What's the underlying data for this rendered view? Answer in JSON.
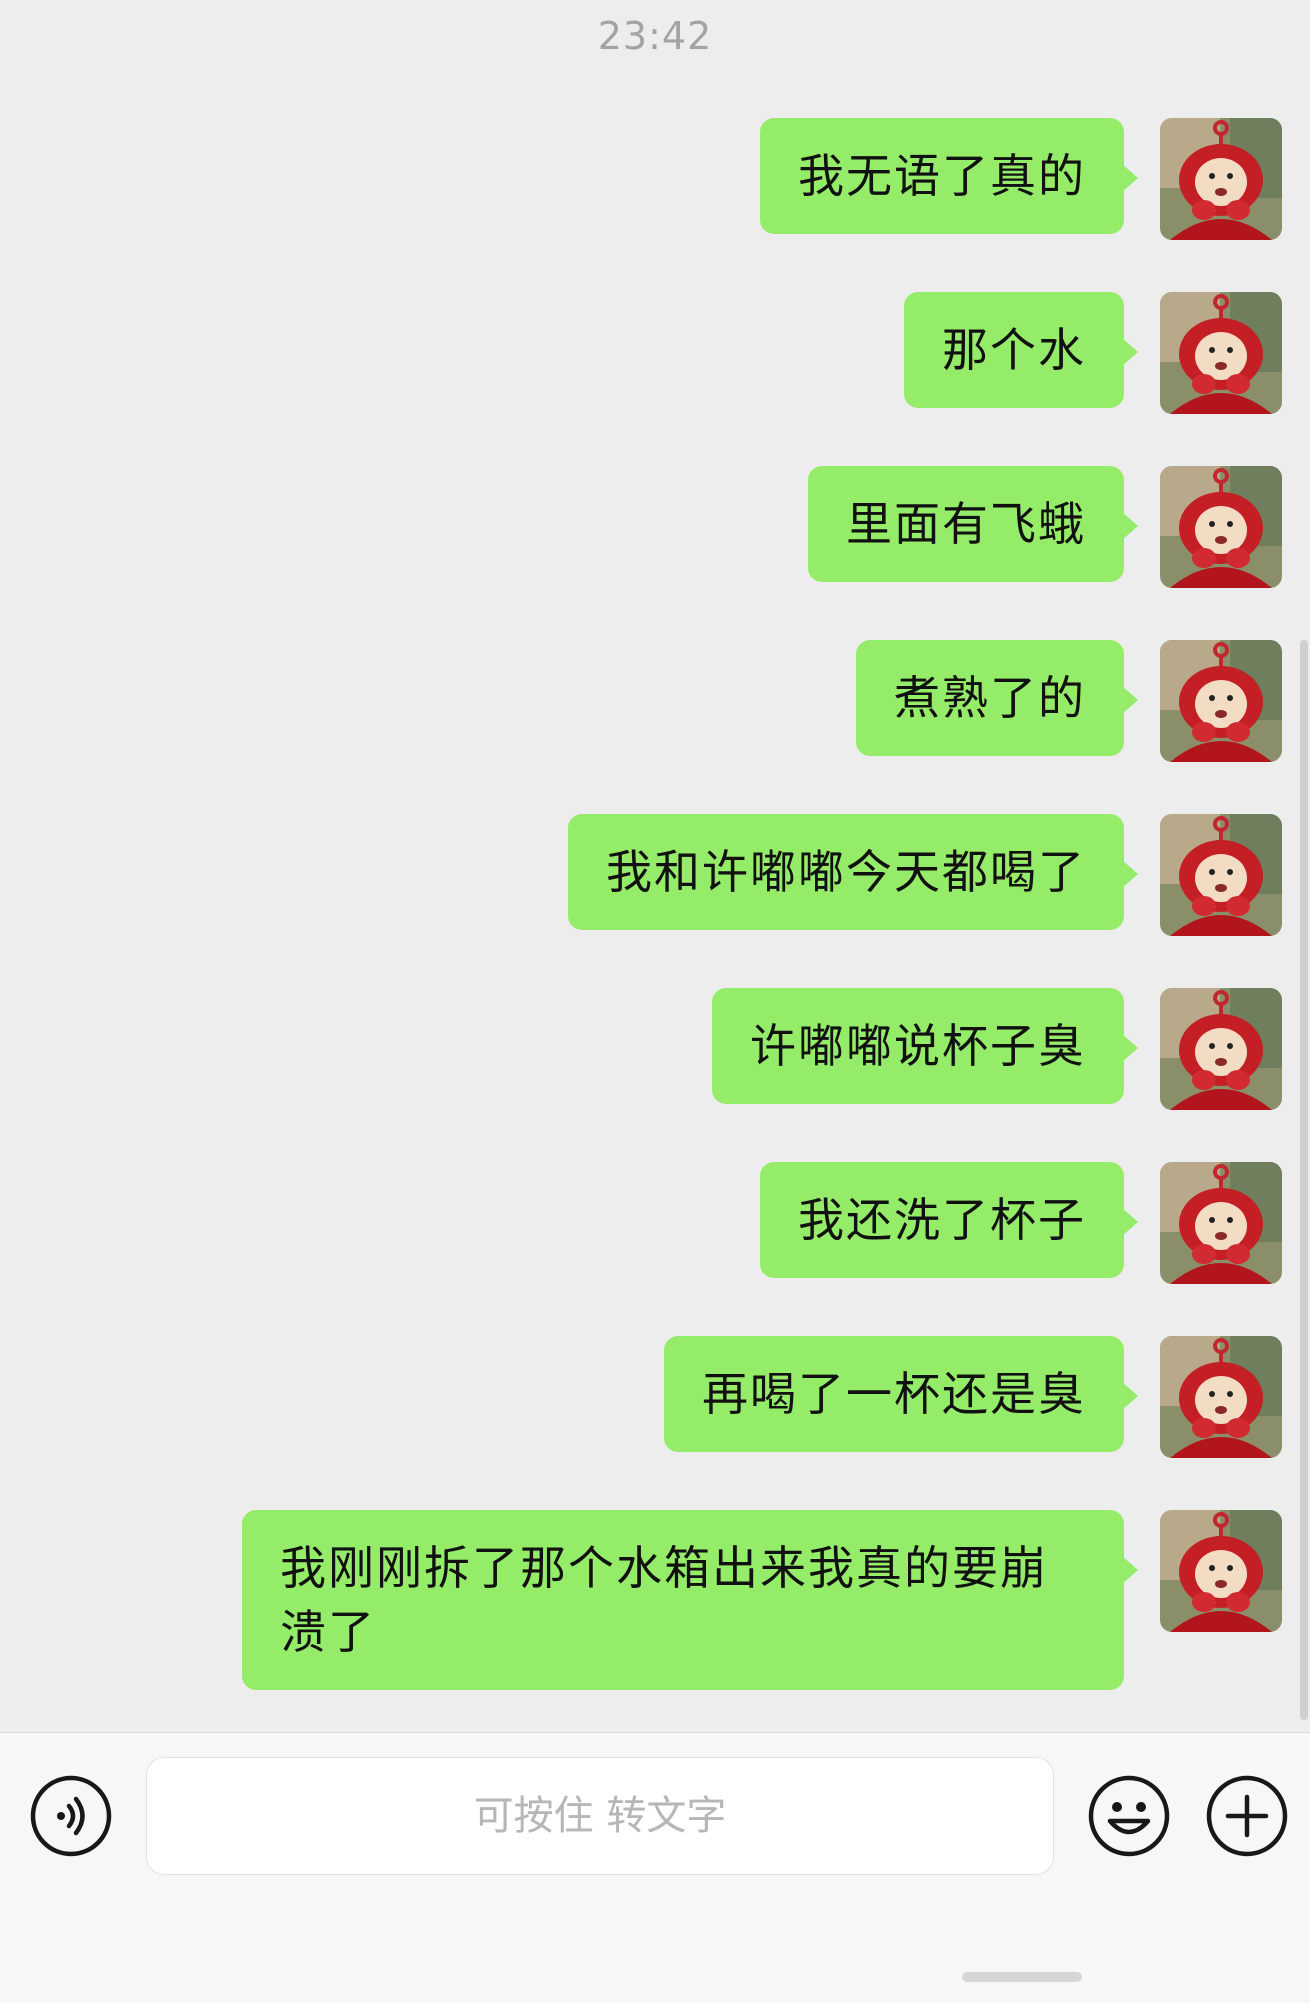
{
  "time_label": "23:42",
  "messages": [
    {
      "sender": "me",
      "text": "我无语了真的"
    },
    {
      "sender": "me",
      "text": "那个水"
    },
    {
      "sender": "me",
      "text": "里面有飞蛾"
    },
    {
      "sender": "me",
      "text": "煮熟了的"
    },
    {
      "sender": "me",
      "text": "我和许嘟嘟今天都喝了"
    },
    {
      "sender": "me",
      "text": "许嘟嘟说杯子臭"
    },
    {
      "sender": "me",
      "text": "我还洗了杯子"
    },
    {
      "sender": "me",
      "text": "再喝了一杯还是臭"
    },
    {
      "sender": "me",
      "text": "我刚刚拆了那个水箱出来我真的要崩溃了"
    }
  ],
  "input_bar": {
    "placeholder": "可按住 转文字",
    "voice_icon": "voice-icon",
    "emoji_icon": "emoji-icon",
    "plus_icon": "plus-icon"
  },
  "colors": {
    "background": "#ededed",
    "bubble_me": "#95ec69",
    "timestamp": "#a3a3a3"
  }
}
